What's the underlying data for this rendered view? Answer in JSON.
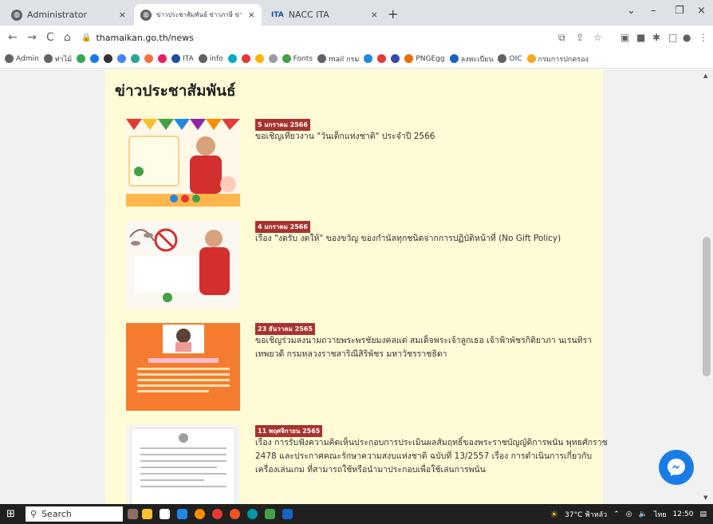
{
  "tabs": [
    {
      "label": "Administrator",
      "close": "×"
    },
    {
      "label": "ข่าวประชาสัมพันธ์ ข่าวภาษี ข่าวกิจกรรม",
      "close": "×"
    },
    {
      "label": "NACC ITA",
      "close": "×"
    }
  ],
  "window": {
    "newtab": "+",
    "dropdown": "⌄",
    "minimize": "–",
    "maximize": "❐",
    "close": "×"
  },
  "address": {
    "url": "thamaikan.go.th/news",
    "back": "←",
    "forward": "→",
    "reload": "C",
    "home": "⌂",
    "lock": "🔒"
  },
  "bookmarks": [
    {
      "label": "Admin",
      "color": "#5f6368"
    },
    {
      "label": "ท่าไม้",
      "color": "#5f6368"
    },
    {
      "label": "",
      "color": "#34a853"
    },
    {
      "label": "",
      "color": "#1877f2"
    },
    {
      "label": "",
      "color": "#333333"
    },
    {
      "label": "",
      "color": "#4285f4"
    },
    {
      "label": "",
      "color": "#26a69a"
    },
    {
      "label": "",
      "color": "#ff7043"
    },
    {
      "label": "",
      "color": "#e91e63"
    },
    {
      "label": "ITA",
      "color": "#1a4fa0"
    },
    {
      "label": "info",
      "color": "#5f6368"
    },
    {
      "label": "",
      "color": "#00acc1"
    },
    {
      "label": "",
      "color": "#e53935"
    },
    {
      "label": "",
      "color": "#ffb300"
    },
    {
      "label": "",
      "color": "#9e9e9e"
    },
    {
      "label": "Fonts",
      "color": "#43a047"
    },
    {
      "label": "mail กรม",
      "color": "#5f6368"
    },
    {
      "label": "",
      "color": "#1e88e5"
    },
    {
      "label": "",
      "color": "#e53935"
    },
    {
      "label": "",
      "color": "#3949ab"
    },
    {
      "label": "PNGEgg",
      "color": "#ef6c00"
    },
    {
      "label": "ลงทะเบียน",
      "color": "#1565c0"
    },
    {
      "label": "OIC",
      "color": "#5f6368"
    },
    {
      "label": "กรมการปกครอง",
      "color": "#f9a825"
    }
  ],
  "page": {
    "heading": "ข่าวประชาสัมพันธ์"
  },
  "news": [
    {
      "date": "5 มกราคม 2566",
      "title": "ขอเชิญเที่ยวงาน \"วันเด็กแห่งชาติ\" ประจำปี 2566"
    },
    {
      "date": "4 มกราคม 2566",
      "title": "เรื่อง \"งดรับ งดให้\" ของขวัญ ของกำนัลทุกชนิดจากการปฏิบัติหน้าที่ (No Gift Policy)"
    },
    {
      "date": "23 ธันวาคม 2565",
      "title": "ขอเชิญร่วมลงนามถวายพระพรชัยมงคลแด่ สมเด็จพระเจ้าลูกเธอ เจ้าฟ้าพัชรกิติยาภา นเรนทิราเทพยวดี กรมหลวงราชสาริณีสิริพัชร มหาวัชรราชธิดา"
    },
    {
      "date": "11 พฤศจิกายน 2565",
      "title": "เรื่อง การรับฟังความคิดเห็นประกอบการประเมินผลสัมฤทธิ์ของพระราชบัญญัติการพนัน พุทธศักราช 2478 และประกาศคณะรักษาความสงบแห่งชาติ ฉบับที่ 13/2557 เรื่อง การดำเนินการเกี่ยวกับเครื่องเล่นเกม ที่สามารถใช้หรือนำมาประกอบเพื่อใช้เล่นการพนัน"
    }
  ],
  "taskbar": {
    "search": "Search",
    "weather": "37°C ฟ้าหลัว",
    "lang": "ไทย",
    "time": "12:50"
  }
}
